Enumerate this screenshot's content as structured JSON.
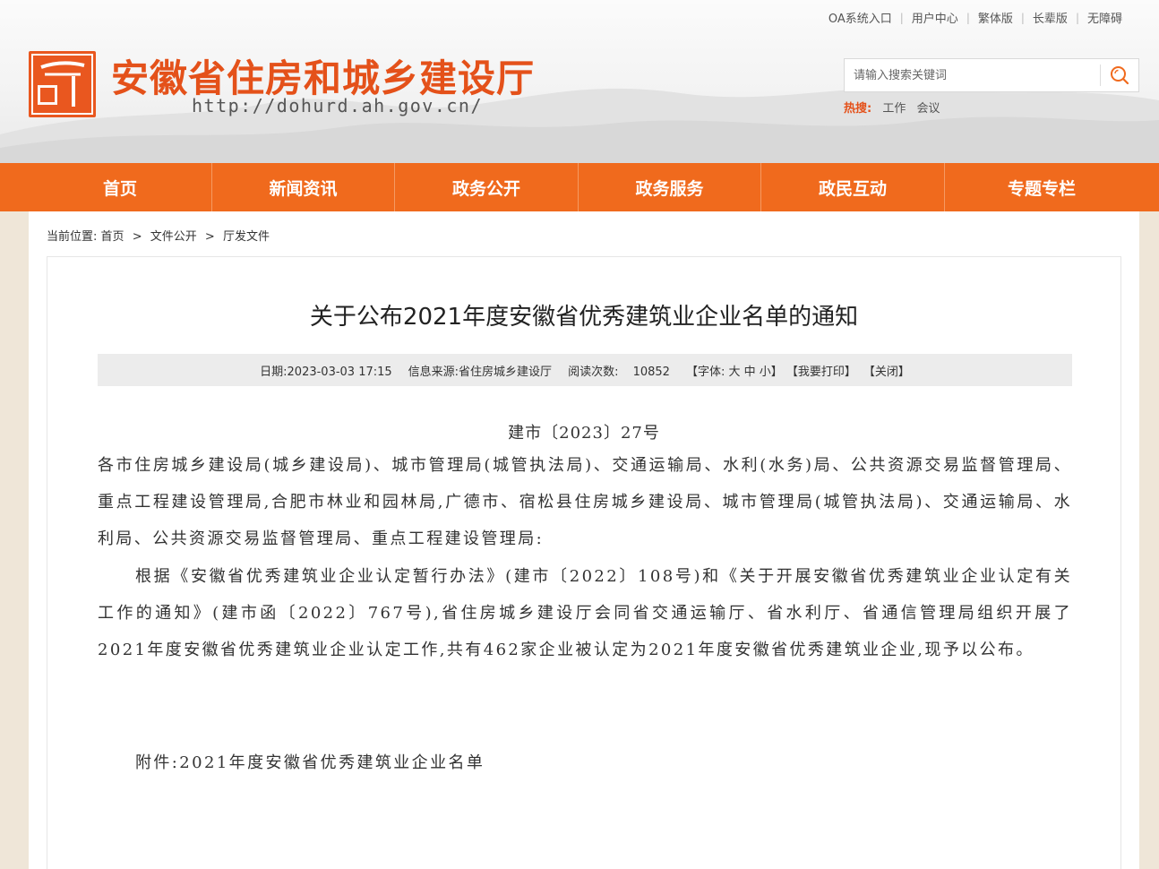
{
  "top_links": [
    "OA系统入口",
    "用户中心",
    "繁体版",
    "长辈版",
    "无障碍"
  ],
  "site": {
    "title": "安徽省住房和城乡建设厅",
    "url": "http://dohurd.ah.gov.cn/",
    "logo_icon": "anhui-housing-construction-logo",
    "brand_color": "#e4511a"
  },
  "search": {
    "placeholder": "请输入搜索关键词",
    "icon": "search-icon"
  },
  "hot_search": {
    "label": "热搜:",
    "items": [
      "工作",
      "会议"
    ]
  },
  "nav": {
    "items": [
      "首页",
      "新闻资讯",
      "政务公开",
      "政务服务",
      "政民互动",
      "专题专栏"
    ],
    "color": "#f06a1d"
  },
  "breadcrumb": {
    "label": "当前位置:",
    "items": [
      "首页",
      "文件公开",
      "厅发文件"
    ],
    "separator": ">"
  },
  "article": {
    "title": "关于公布2021年度安徽省优秀建筑业企业名单的通知",
    "meta": {
      "date": "日期:2023-03-03 17:15",
      "source": "信息来源:省住房城乡建设厅",
      "reads_label": "阅读次数:",
      "reads_count": "10852",
      "font_label": "【字体:",
      "font_large": "大",
      "font_medium": "中",
      "font_small": "小】",
      "print": "【我要打印】",
      "close": "【关闭】"
    },
    "doc_no": "建市〔2023〕27号",
    "recipients": "各市住房城乡建设局(城乡建设局)、城市管理局(城管执法局)、交通运输局、水利(水务)局、公共资源交易监督管理局、重点工程建设管理局,合肥市林业和园林局,广德市、宿松县住房城乡建设局、城市管理局(城管执法局)、交通运输局、水利局、公共资源交易监督管理局、重点工程建设管理局:",
    "paragraph": "根据《安徽省优秀建筑业企业认定暂行办法》(建市〔2022〕108号)和《关于开展安徽省优秀建筑业企业认定有关工作的通知》(建市函〔2022〕767号),省住房城乡建设厅会同省交通运输厅、省水利厅、省通信管理局组织开展了2021年度安徽省优秀建筑业企业认定工作,共有462家企业被认定为2021年度安徽省优秀建筑业企业,现予以公布。",
    "attachment": "附件:2021年度安徽省优秀建筑业企业名单"
  }
}
